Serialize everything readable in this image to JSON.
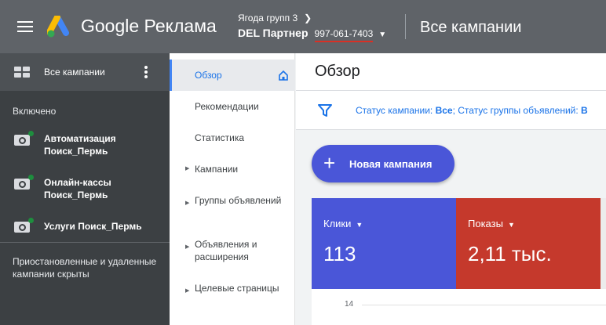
{
  "header": {
    "logo_text": "Google Реклама",
    "account_name": "Ягода групп 3",
    "account_client": "DEL Партнер",
    "account_id": "997-061-7403",
    "page_title": "Все кампании"
  },
  "sidebar": {
    "header_label": "Все кампании",
    "section_enabled": "Включено",
    "campaigns": [
      {
        "label": "Автоматизация Поиск_Пермь",
        "status_color": "#1e8e3e",
        "icon": "search-campaign-icon"
      },
      {
        "label": "Онлайн-кассы Поиск_Пермь",
        "status_color": "#1e8e3e",
        "icon": "search-campaign-icon"
      },
      {
        "label": "Услуги Поиск_Пермь",
        "status_color": "#1e8e3e",
        "icon": "search-campaign-icon"
      }
    ],
    "hidden_note": "Приостановленные и удаленные кампании скрыты"
  },
  "nav": {
    "items": [
      {
        "label": "Обзор",
        "active": true
      },
      {
        "label": "Рекомендации"
      },
      {
        "label": "Статистика"
      },
      {
        "label": "Кампании",
        "expandable": true
      },
      {
        "label": "Группы объявлений",
        "expandable": true
      },
      {
        "label": "Объявления и расширения",
        "expandable": true
      },
      {
        "label": "Целевые страницы",
        "expandable": true
      }
    ]
  },
  "main": {
    "title": "Обзор",
    "filter": {
      "prefix1": "Статус кампании: ",
      "value1": "Все",
      "sep": "; ",
      "prefix2": "Статус группы объявлений: ",
      "value2": "В"
    },
    "new_campaign_label": "Новая кампания",
    "metrics": [
      {
        "name": "Клики",
        "value": "113",
        "color": "#4a56d8"
      },
      {
        "name": "Показы",
        "value": "2,11 тыс.",
        "color": "#c5392c"
      }
    ],
    "chart_tick": "14"
  }
}
